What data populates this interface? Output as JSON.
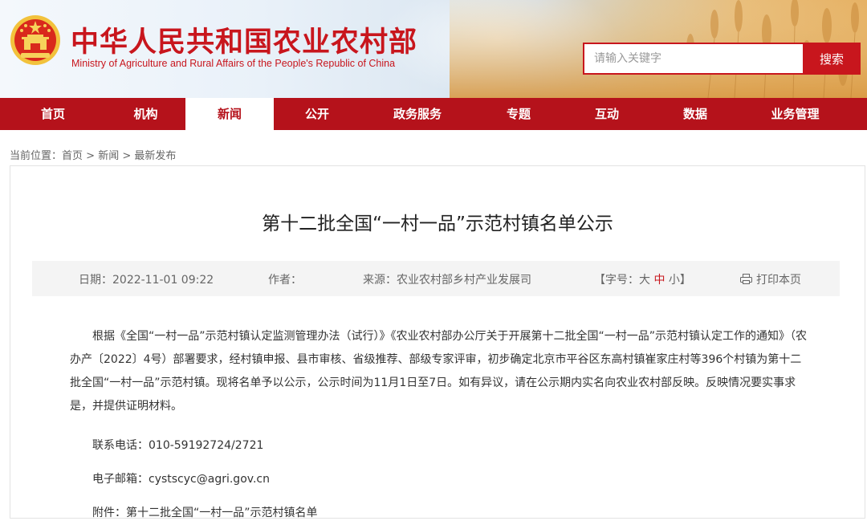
{
  "header": {
    "cn_title": "中华人民共和国农业农村部",
    "en_title": "Ministry of Agriculture and Rural Affairs of the People's Republic of China",
    "search_placeholder": "请输入关键字",
    "search_button": "搜索",
    "brand_color": "#c8161d",
    "emblem_icon": "national-emblem-icon"
  },
  "nav": {
    "items": [
      {
        "label": "首页"
      },
      {
        "label": "机构"
      },
      {
        "label": "新闻",
        "active": true
      },
      {
        "label": "公开"
      },
      {
        "label": "政务服务"
      },
      {
        "label": "专题"
      },
      {
        "label": "互动"
      },
      {
        "label": "数据"
      },
      {
        "label": "业务管理"
      }
    ]
  },
  "breadcrumb": {
    "prefix": "当前位置：",
    "items": [
      "首页",
      "新闻",
      "最新发布"
    ],
    "separator": " > "
  },
  "article": {
    "title": "第十二批全国“一村一品”示范村镇名单公示",
    "meta": {
      "date_label": "日期：",
      "date_value": "2022-11-01 09:22",
      "author_label": "作者：",
      "author_value": "",
      "source_label": "来源：",
      "source_value": "农业农村部乡村产业发展司",
      "font_size_label": "【字号：",
      "size_large": "大",
      "size_medium": "中",
      "size_small": "小",
      "font_size_close": "】",
      "print_label": "打印本页",
      "print_icon": "printer-icon"
    },
    "paragraph": "根据《全国“一村一品”示范村镇认定监测管理办法（试行）》《农业农村部办公厅关于开展第十二批全国“一村一品”示范村镇认定工作的通知》（农办产〔2022〕4号）部署要求，经村镇申报、县市审核、省级推荐、部级专家评审，初步确定北京市平谷区东高村镇崔家庄村等396个村镇为第十二批全国“一村一品”示范村镇。现将名单予以公示，公示时间为11月1日至7日。如有异议，请在公示期内实名向农业农村部反映。反映情况要实事求是，并提供证明材料。",
    "phone_label": "联系电话：",
    "phone_value": "010-59192724/2721",
    "email_label": "电子邮箱：",
    "email_value": "cystscyc@agri.gov.cn",
    "attachment_label": "附件：",
    "attachment_value": "第十二批全国“一村一品”示范村镇名单"
  }
}
